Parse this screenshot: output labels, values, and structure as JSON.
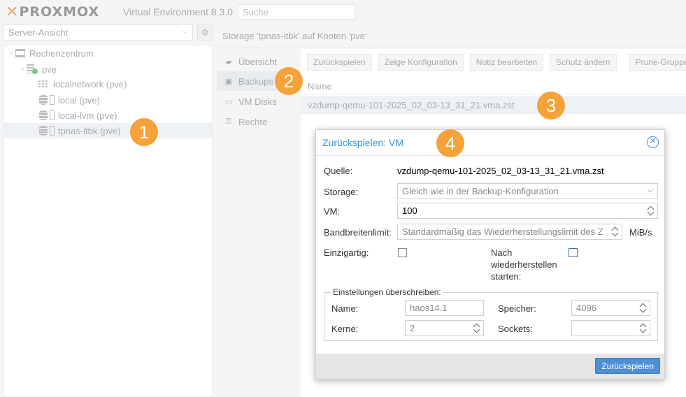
{
  "header": {
    "brand": "PROXMOX",
    "version": "Virtual Environment 8.3.0",
    "search_placeholder": "Suche"
  },
  "sidebar": {
    "view_selector": "Server-Ansicht",
    "tree": [
      {
        "label": "Rechenzentrum",
        "icon": "datacenter-icon"
      },
      {
        "label": "pve",
        "icon": "node-icon"
      },
      {
        "label": "localnetwork (pve)",
        "icon": "network-icon"
      },
      {
        "label": "local (pve)",
        "icon": "storage-icon"
      },
      {
        "label": "local-lvm (pve)",
        "icon": "storage-icon"
      },
      {
        "label": "tpnas-itbk (pve)",
        "icon": "storage-icon",
        "selected": true
      }
    ]
  },
  "breadcrumb": "Storage 'tpnas-itbk' auf Knoten 'pve'",
  "storage_nav": [
    {
      "label": "Übersicht",
      "icon": "book-icon"
    },
    {
      "label": "Backups",
      "icon": "floppy-icon",
      "active": true
    },
    {
      "label": "VM Disks",
      "icon": "hdd-icon"
    },
    {
      "label": "Rechte",
      "icon": "unlock-icon"
    }
  ],
  "toolbar": {
    "restore": "Zurückspielen",
    "show_config": "Zeige Konfiguration",
    "edit_note": "Notiz bearbeiten",
    "change_protection": "Schutz ändern",
    "prune_group": "Prune-Gruppe"
  },
  "backup_grid": {
    "column_name": "Name",
    "rows": [
      "vzdump-qemu-101-2025_02_03-13_31_21.vma.zst"
    ]
  },
  "dialog": {
    "title": "Zurückspielen: VM",
    "source_label": "Quelle:",
    "source_value": "vzdump-qemu-101-2025_02_03-13_31_21.vma.zst",
    "storage_label": "Storage:",
    "storage_value": "Gleich wie in der Backup-Konfiguration",
    "vm_label": "VM:",
    "vm_value": "100",
    "bandwidth_label": "Bandbreitenlimit:",
    "bandwidth_value": "Standardmäßig das Wiederherstellungslimit des Z",
    "bandwidth_unit": "MiB/s",
    "unique_label": "Einzigartig:",
    "start_after_restore_label_1": "Nach",
    "start_after_restore_label_2": "wiederherstellen",
    "start_after_restore_label_3": "starten:",
    "override_legend": "Einstellungen überschreiben:",
    "name_label": "Name:",
    "name_value": "haos14.1",
    "cores_label": "Kerne:",
    "cores_value": "2",
    "memory_label": "Speicher:",
    "memory_value": "4096",
    "sockets_label": "Sockets:",
    "sockets_value": "",
    "restore_button": "Zurückspielen"
  },
  "markers": [
    "1",
    "2",
    "3",
    "4"
  ],
  "colors": {
    "accent": "#3892d4",
    "marker": "#f5a23a",
    "primary_button": "#4f90d5"
  }
}
